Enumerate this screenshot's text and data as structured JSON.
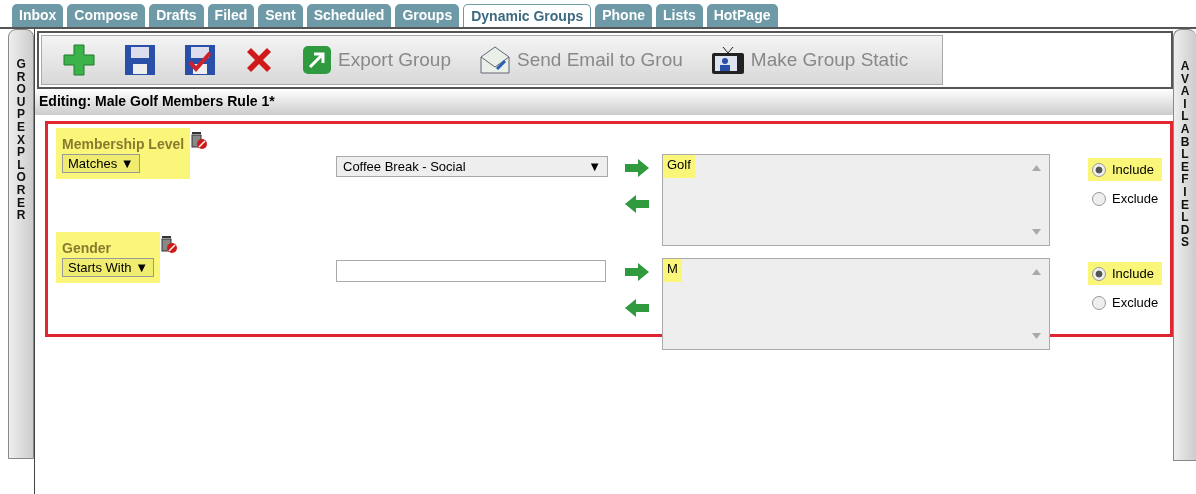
{
  "tabs": [
    {
      "label": "Inbox",
      "selected": false
    },
    {
      "label": "Compose",
      "selected": false
    },
    {
      "label": "Drafts",
      "selected": false
    },
    {
      "label": "Filed",
      "selected": false
    },
    {
      "label": "Sent",
      "selected": false
    },
    {
      "label": "Scheduled",
      "selected": false
    },
    {
      "label": "Groups",
      "selected": false
    },
    {
      "label": "Dynamic Groups",
      "selected": true
    },
    {
      "label": "Phone",
      "selected": false
    },
    {
      "label": "Lists",
      "selected": false
    },
    {
      "label": "HotPage",
      "selected": false
    }
  ],
  "left_sidebar": {
    "label": "GROUP EXPLORER"
  },
  "right_sidebar": {
    "label": "AVAILABLE FIELDS"
  },
  "toolbar": [
    {
      "kind": "add"
    },
    {
      "kind": "save"
    },
    {
      "kind": "save-check"
    },
    {
      "kind": "delete"
    },
    {
      "kind": "export",
      "label": "Export Group"
    },
    {
      "kind": "email",
      "label": "Send Email to Grou"
    },
    {
      "kind": "static",
      "label": "Make Group Static"
    }
  ],
  "editing_title": "Editing: Male Golf Members Rule 1*",
  "rules": [
    {
      "field": "Membership Level",
      "operator": "Matches ▼",
      "kind": "select",
      "input_value": "Coffee Break - Social",
      "caret": "▼",
      "values": [
        "Golf"
      ],
      "options": [
        {
          "label": "Include",
          "selected": true
        },
        {
          "label": "Exclude",
          "selected": false
        }
      ]
    },
    {
      "field": "Gender",
      "operator": "Starts With ▼",
      "kind": "text",
      "values": [
        "M"
      ],
      "options": [
        {
          "label": "Include",
          "selected": true
        },
        {
          "label": "Exclude",
          "selected": false
        }
      ]
    }
  ]
}
